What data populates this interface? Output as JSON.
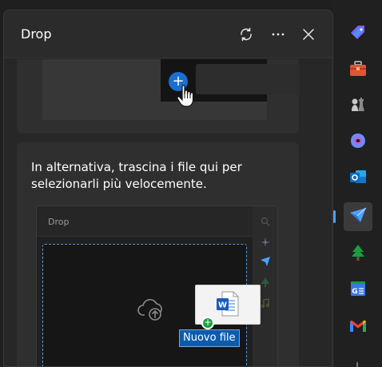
{
  "panel": {
    "title": "Drop",
    "header_actions": {
      "refresh": "refresh-icon",
      "more": "more-icon",
      "close": "close-icon"
    }
  },
  "card1": {
    "plus_symbol": "+",
    "pointer_icon": "hand-pointer-icon"
  },
  "card2": {
    "instruction": "In alternativa, trascina i file qui per selezionarli più velocemente.",
    "mini_window_title": "Drop",
    "upload_icon": "cloud-upload-icon",
    "file_icon": "word-document-icon",
    "drag_label": "Nuovo file"
  },
  "sidebar": {
    "items": [
      {
        "icon": "tag-icon",
        "color": "#7b61ff"
      },
      {
        "icon": "toolbox-icon",
        "color": "#e0533d"
      },
      {
        "icon": "chess-icon",
        "color": "#c8c8c8"
      },
      {
        "icon": "copilot-icon",
        "color": "#6b8cff"
      },
      {
        "icon": "outlook-icon",
        "color": "#0f6cbd"
      },
      {
        "icon": "drop-icon",
        "color": "#4ea0ff",
        "active": true
      },
      {
        "icon": "tree-icon",
        "color": "#1a9d3c"
      },
      {
        "icon": "news-icon",
        "color": "#3b78e7"
      },
      {
        "icon": "gmail-icon",
        "color": "#ea4335"
      }
    ]
  }
}
